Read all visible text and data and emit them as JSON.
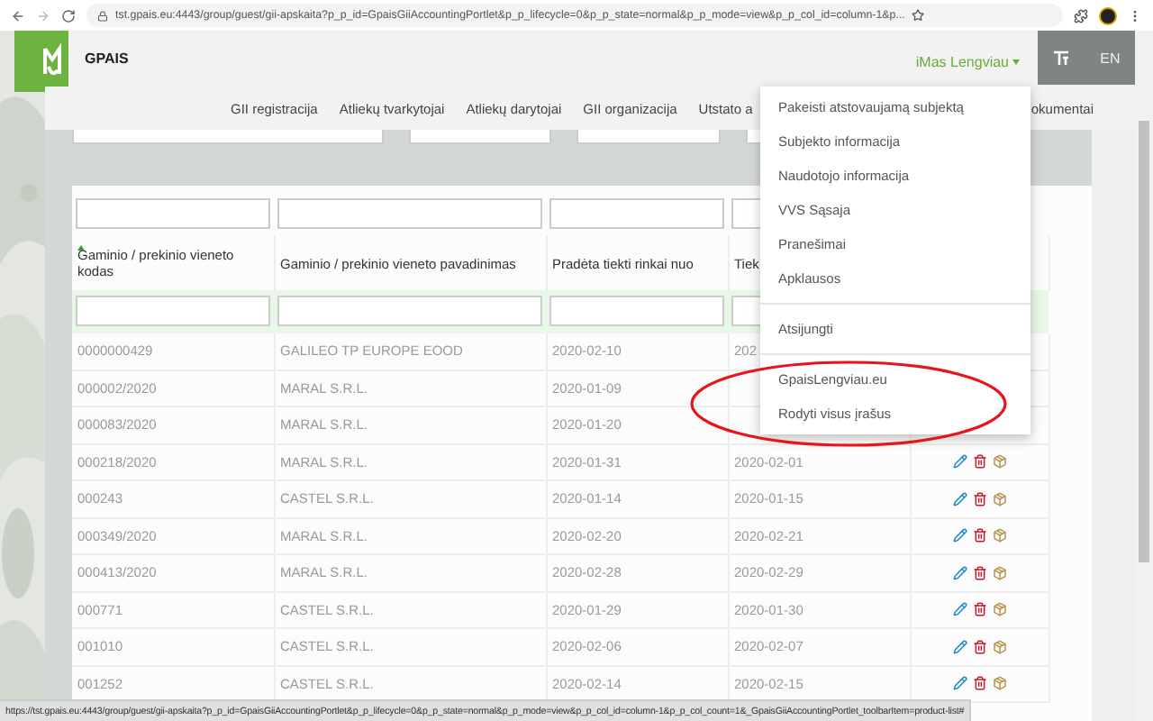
{
  "browser": {
    "url": "tst.gpais.eu:4443/group/guest/gii-apskaita?p_p_id=GpaisGiiAccountingPortlet&p_p_lifecycle=0&p_p_state=normal&p_p_mode=view&p_p_col_id=column-1&p..."
  },
  "header": {
    "title": "GPAIS",
    "user_menu": "iMas Lengviau",
    "language": "EN"
  },
  "nav": [
    "GII registracija",
    "Atliekų tvarkytojai",
    "Atliekų darytojai",
    "GII organizacija",
    "Utstato a",
    "okumentai"
  ],
  "table": {
    "columns": [
      {
        "label": "Gaminio / prekinio vieneto kodas",
        "sorted": true
      },
      {
        "label": "Gaminio / prekinio vieneto pavadinimas",
        "sorted": false
      },
      {
        "label": "Pradėta tiekti rinkai nuo",
        "sorted": false
      },
      {
        "label": "Tiek",
        "sorted": false
      }
    ],
    "rows": [
      {
        "cells": [
          "0000000429",
          "GALILEO TP EUROPE EOOD",
          "2020-02-10",
          "202"
        ]
      },
      {
        "cells": [
          "000002/2020",
          "MARAL S.R.L.",
          "2020-01-09"
        ]
      },
      {
        "cells": [
          "000083/2020",
          "MARAL S.R.L.",
          "2020-01-20"
        ]
      },
      {
        "cells": [
          "000218/2020",
          "MARAL S.R.L.",
          "2020-01-31",
          "2020-02-01"
        ],
        "actions": [
          {
            "kind": "edit"
          },
          {
            "kind": "delete"
          },
          {
            "kind": "package"
          }
        ]
      },
      {
        "cells": [
          "000243",
          "CASTEL S.R.L.",
          "2020-01-14",
          "2020-01-15"
        ],
        "actions": [
          {
            "kind": "edit"
          },
          {
            "kind": "delete"
          },
          {
            "kind": "package"
          }
        ]
      },
      {
        "cells": [
          "000349/2020",
          "MARAL S.R.L.",
          "2020-02-20",
          "2020-02-21"
        ],
        "actions": [
          {
            "kind": "edit"
          },
          {
            "kind": "delete"
          },
          {
            "kind": "package"
          }
        ]
      },
      {
        "cells": [
          "000413/2020",
          "MARAL S.R.L.",
          "2020-02-28",
          "2020-02-29"
        ],
        "actions": [
          {
            "kind": "edit"
          },
          {
            "kind": "delete"
          },
          {
            "kind": "package"
          }
        ]
      },
      {
        "cells": [
          "000771",
          "CASTEL S.R.L.",
          "2020-01-29",
          "2020-01-30"
        ],
        "actions": [
          {
            "kind": "edit"
          },
          {
            "kind": "delete"
          },
          {
            "kind": "package"
          }
        ]
      },
      {
        "cells": [
          "001010",
          "CASTEL S.R.L.",
          "2020-02-06",
          "2020-02-07"
        ],
        "actions": [
          {
            "kind": "edit"
          },
          {
            "kind": "delete"
          },
          {
            "kind": "package"
          }
        ]
      },
      {
        "cells": [
          "001252",
          "CASTEL S.R.L.",
          "2020-02-14",
          "2020-02-15"
        ],
        "actions": [
          {
            "kind": "edit"
          },
          {
            "kind": "delete"
          },
          {
            "kind": "package"
          }
        ]
      }
    ]
  },
  "user_dropdown": [
    [
      "Pakeisti atstovaujamą subjektą",
      "Subjekto informacija",
      "Naudotojo informacija",
      "VVS Sąsaja",
      "Pranešimai",
      "Apklausos"
    ],
    [
      "Atsijungti"
    ],
    [
      "GpaisLengviau.eu",
      "Rodyti visus įrašus"
    ]
  ],
  "status_bar": "https://tst.gpais.eu:4443/group/guest/gii-apskaita?p_p_id=GpaisGiiAccountingPortlet&p_p_lifecycle=0&p_p_state=normal&p_p_mode=view&p_p_col_id=column-1&p_p_col_count=1&_GpaisGiiAccountingPortlet_toolbarItem=product-list#"
}
